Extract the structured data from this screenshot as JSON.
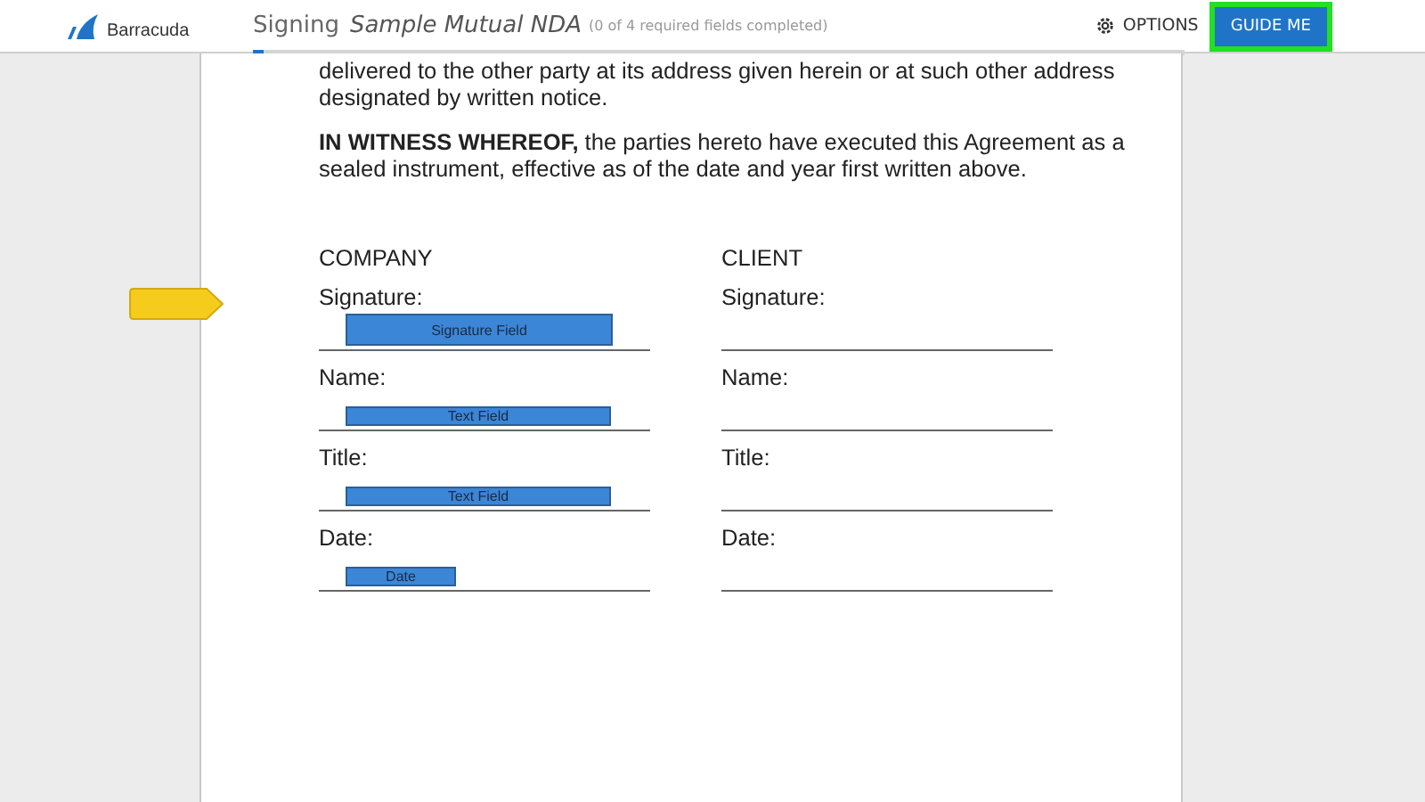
{
  "header": {
    "logo": "Barracuda",
    "mode": "Signing",
    "document_title": "Sample Mutual NDA",
    "status": "(0 of 4 required fields completed)",
    "progress": {
      "level": 0.012
    },
    "options_label": "OPTIONS",
    "guide_button": {
      "label": "GUIDE ME",
      "highlighted": true
    }
  },
  "document": {
    "paragraphs": [
      "delivered to the other party at its address given herein or at such other address designated by written notice.",
      "**IN WITNESS WHEREOF,** the parties hereto have executed this Agreement as a sealed instrument, effective as of the date and year first written above."
    ],
    "columns": [
      {
        "heading": "COMPANY",
        "rows": [
          {
            "label": "Signature:",
            "field": {
              "kind": "signature",
              "text": "Signature Field"
            }
          },
          {
            "label": "Name:",
            "field": {
              "kind": "text",
              "text": "Text Field"
            }
          },
          {
            "label": "Title:",
            "field": {
              "kind": "text",
              "text": "Text Field"
            }
          },
          {
            "label": "Date:",
            "field": {
              "kind": "date",
              "text": "Date"
            }
          }
        ]
      },
      {
        "heading": "CLIENT",
        "rows": [
          {
            "label": "Signature:"
          },
          {
            "label": "Name:"
          },
          {
            "label": "Title:"
          },
          {
            "label": "Date:"
          }
        ]
      }
    ]
  }
}
